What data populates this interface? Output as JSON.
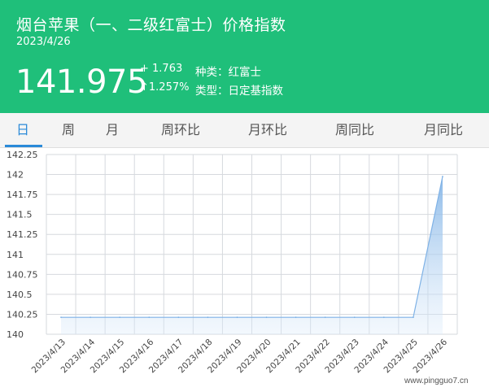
{
  "header": {
    "title": "烟台苹果（一、二级红富士）价格指数",
    "date": "2023/4/26",
    "price": "141.975",
    "change_abs": "+ 1.763",
    "change_pct": "↑1.257%",
    "variety": "种类：红富士",
    "index_type": "类型：日定基指数"
  },
  "tabs": [
    "日",
    "周",
    "月",
    "周环比",
    "月环比",
    "周同比",
    "月同比"
  ],
  "active_tab": 0,
  "watermark": "www.pingguo7.cn",
  "colors": {
    "header_bg": "#1fbf7a",
    "active_tab": "#2a8ad8",
    "series_line": "#7fb2e6",
    "area_top": "#7fb2e6"
  },
  "chart_data": {
    "type": "area",
    "title": "",
    "xlabel": "",
    "ylabel": "",
    "x": [
      "2023/4/13",
      "2023/4/14",
      "2023/4/15",
      "2023/4/16",
      "2023/4/17",
      "2023/4/18",
      "2023/4/19",
      "2023/4/20",
      "2023/4/21",
      "2023/4/22",
      "2023/4/23",
      "2023/4/24",
      "2023/4/25",
      "2023/4/26"
    ],
    "series": [
      {
        "values": [
          140.212,
          140.212,
          140.212,
          140.212,
          140.212,
          140.212,
          140.212,
          140.212,
          140.212,
          140.212,
          140.212,
          140.212,
          140.212,
          141.975
        ]
      }
    ],
    "ylim": [
      140,
      142.25
    ],
    "yticks": [
      "142.25",
      "142",
      "141.75",
      "141.5",
      "141.25",
      "141",
      "140.75",
      "140.5",
      "140.25",
      "140"
    ],
    "grid": true
  }
}
